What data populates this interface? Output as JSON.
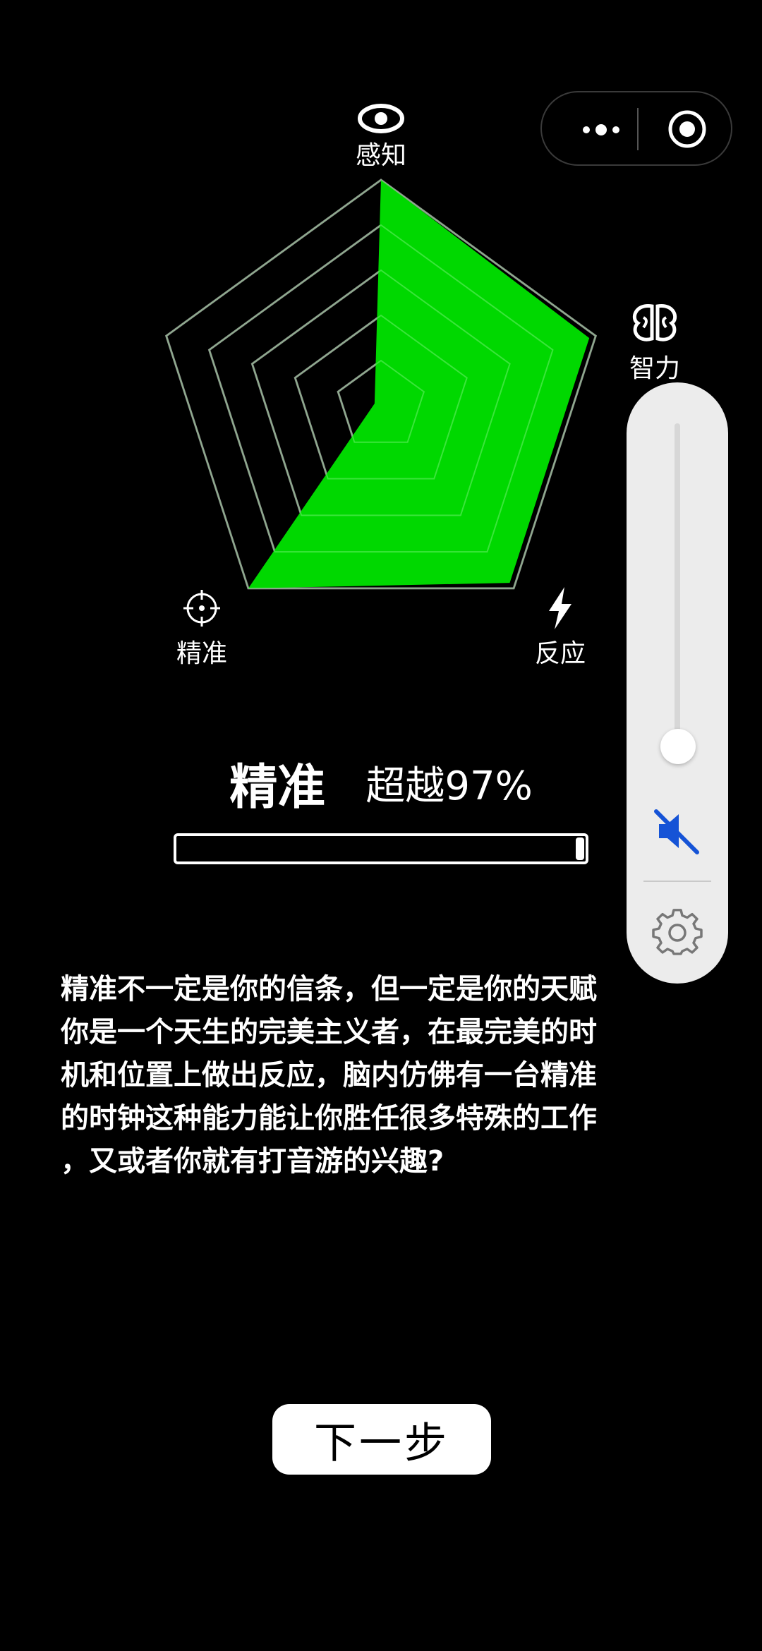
{
  "colors": {
    "background": "#000000",
    "radar_fill": "#00d800",
    "radar_grid": "#808080",
    "panel_bg": "#ececec",
    "mute_icon": "#1553d6"
  },
  "menu_capsule": {
    "more_icon": "more-dots-icon",
    "close_icon": "target-close-icon"
  },
  "chart_data": {
    "type": "radar",
    "axes": [
      {
        "label": "感知",
        "icon": "eye-icon",
        "value": 1.0
      },
      {
        "label": "智力",
        "icon": "brain-icon",
        "value": 0.97
      },
      {
        "label": "反应",
        "icon": "lightning-icon",
        "value": 0.97
      },
      {
        "label": "精准",
        "icon": "crosshair-icon",
        "value": 1.0
      },
      {
        "label": "",
        "icon": "",
        "value": 0.03
      }
    ],
    "rings": 5,
    "range": [
      0,
      1
    ]
  },
  "side_panel": {
    "volume_level": 0.05,
    "mute_icon": "speaker-muted-icon",
    "settings_icon": "gear-icon"
  },
  "result": {
    "name": "精准",
    "percent_text": "超越97%",
    "progress": 0.97
  },
  "description": [
    "精准不一定是你的信条，但一定是你的天赋",
    "你是一个天生的完美主义者，在最完美的时",
    "机和位置上做出反应，脑内仿佛有一台精准",
    "的时钟这种能力能让你胜任很多特殊的工作",
    "，又或者你就有打音游的兴趣?"
  ],
  "next_button": {
    "label": "下一步"
  }
}
